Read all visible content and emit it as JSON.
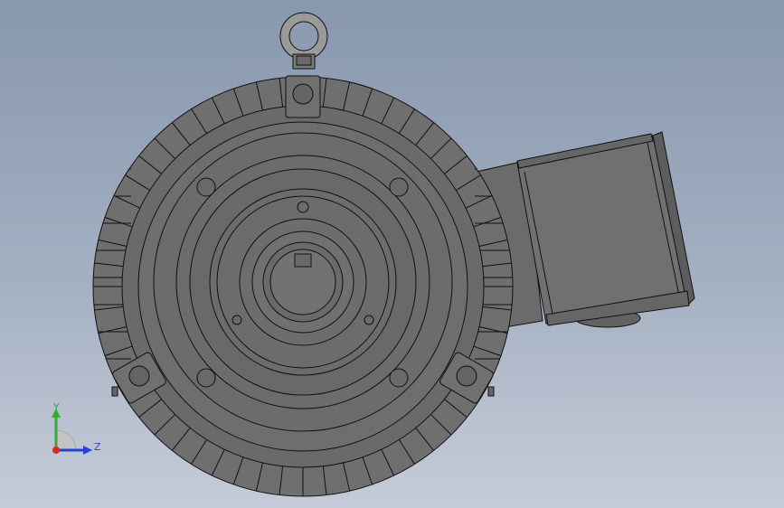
{
  "viewport": {
    "background_top": "#8797ae",
    "background_bottom": "#c5ccd8",
    "model_fill": "#6f6f6f",
    "model_fill_dark": "#5a5a5a",
    "model_fill_light": "#7c7c7c",
    "edge_color": "#111111"
  },
  "triad": {
    "y_label": "Y",
    "z_label": "Z",
    "y_color": "#2fae2f",
    "z_color": "#2a3fd6",
    "x_color": "#d42a2a"
  }
}
